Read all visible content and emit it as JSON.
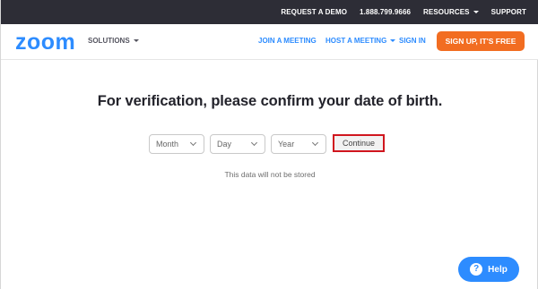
{
  "topbar": {
    "request_demo": "REQUEST A DEMO",
    "phone": "1.888.799.9666",
    "resources": "RESOURCES",
    "support": "SUPPORT"
  },
  "nav": {
    "logo": "zoom",
    "solutions": "SOLUTIONS",
    "join_meeting": "JOIN A MEETING",
    "host_meeting": "HOST A MEETING",
    "sign_in": "SIGN IN",
    "sign_up": "SIGN UP, IT'S FREE"
  },
  "verification": {
    "heading": "For verification, please confirm your date of birth.",
    "month_placeholder": "Month",
    "day_placeholder": "Day",
    "year_placeholder": "Year",
    "continue_label": "Continue",
    "note": "This data will not be stored"
  },
  "help": {
    "icon_glyph": "?",
    "label": "Help"
  },
  "colors": {
    "brand_blue": "#2d8cff",
    "signup_orange": "#f26d21",
    "topbar_bg": "#2d2d36",
    "highlight_red": "#d0161e"
  },
  "icons": {
    "dropdown": "chevron-down-icon",
    "caret": "caret-down-icon",
    "help": "question-circle-icon"
  }
}
